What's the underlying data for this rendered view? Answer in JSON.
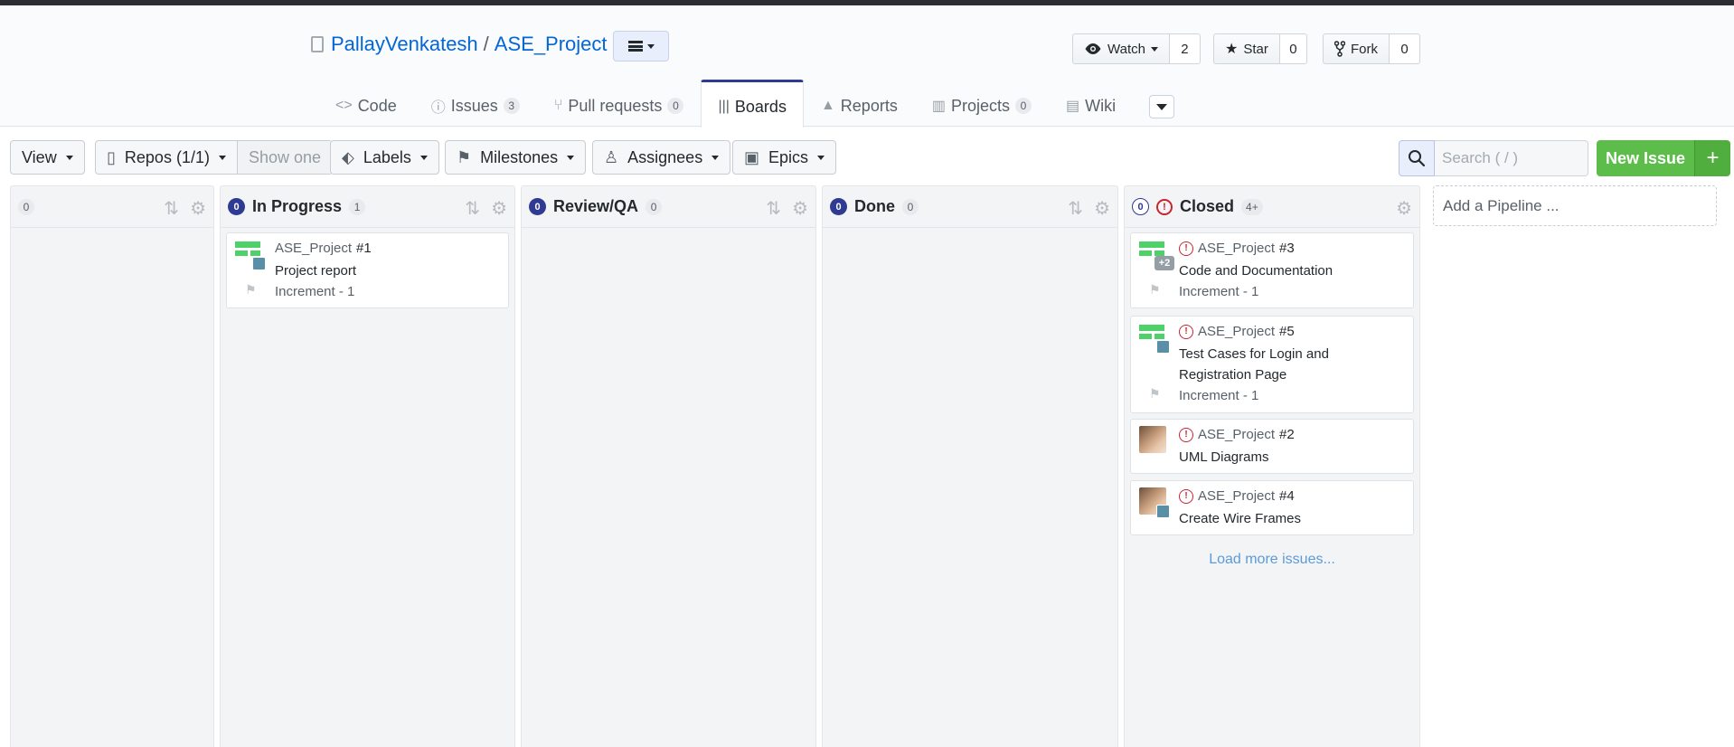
{
  "repo": {
    "owner": "PallayVenkatesh",
    "separator": "/",
    "name": "ASE_Project"
  },
  "social": {
    "watch_label": "Watch",
    "watch_count": "2",
    "star_label": "Star",
    "star_count": "0",
    "fork_label": "Fork",
    "fork_count": "0"
  },
  "nav": {
    "code": "Code",
    "issues": "Issues",
    "issues_count": "3",
    "pulls": "Pull requests",
    "pulls_count": "0",
    "boards": "Boards",
    "reports": "Reports",
    "projects": "Projects",
    "projects_count": "0",
    "wiki": "Wiki"
  },
  "toolbar": {
    "view": "View",
    "repos": "Repos (1/1)",
    "show_one": "Show one",
    "labels": "Labels",
    "milestones": "Milestones",
    "assignees": "Assignees",
    "epics": "Epics",
    "search_placeholder": "Search ( / )",
    "new_issue": "New Issue",
    "plus": "+"
  },
  "pipelines": [
    {
      "name": "",
      "count": "0"
    },
    {
      "name": "In Progress",
      "badge": "0",
      "count": "1"
    },
    {
      "name": "Review/QA",
      "badge": "0",
      "count": "0"
    },
    {
      "name": "Done",
      "badge": "0",
      "count": "0"
    },
    {
      "name": "Closed",
      "badge": "0",
      "count": "4+"
    }
  ],
  "cards": {
    "c1": {
      "repo": "ASE_Project",
      "number": "#1",
      "title": "Project report",
      "milestone": "Increment - 1"
    },
    "c3": {
      "repo": "ASE_Project",
      "number": "#3",
      "title": "Code and Documentation",
      "milestone": "Increment - 1",
      "assignee_extra": "+2"
    },
    "c5": {
      "repo": "ASE_Project",
      "number": "#5",
      "title": "Test Cases for Login and Registration Page",
      "milestone": "Increment - 1"
    },
    "c2": {
      "repo": "ASE_Project",
      "number": "#2",
      "title": "UML Diagrams"
    },
    "c4": {
      "repo": "ASE_Project",
      "number": "#4",
      "title": "Create Wire Frames"
    }
  },
  "load_more": "Load more issues...",
  "add_pipeline": "Add a Pipeline ...",
  "colors": {
    "accent": "#2f3a92",
    "link": "#0366d6",
    "closed": "#cb2431",
    "new_issue": "#5cbd4a"
  }
}
